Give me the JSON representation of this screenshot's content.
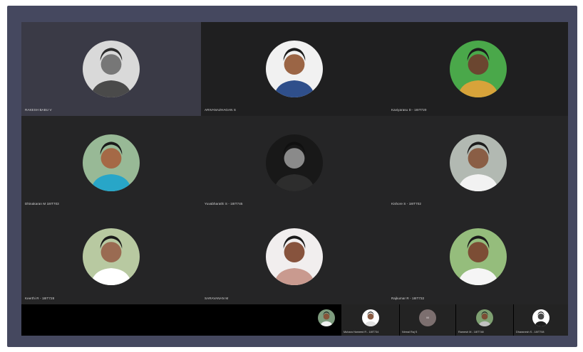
{
  "colors": {
    "frame": "#45485f",
    "meeting_bg": "#1e1e1e",
    "tile_bg": "#252526",
    "active_tile_bg": "#3a3a46",
    "strip_bg": "#000000"
  },
  "participants": [
    {
      "name": "RAKESH BABU V",
      "active": true,
      "bg": "#d9d9d9",
      "skin": "#777777",
      "shirt": "#4a4a4a",
      "hair": "#2c2c2c"
    },
    {
      "name": "ARIVANAZHAGAN S",
      "active": false,
      "bg": "#f1f1f1",
      "skin": "#9b6545",
      "shirt": "#2f4f8b",
      "hair": "#1a1a1a"
    },
    {
      "name": "Kaviyarasu D - 18IT720",
      "active": false,
      "bg": "#4aa84a",
      "skin": "#6b4630",
      "shirt": "#d7a33a",
      "hair": "#1b1b1b"
    },
    {
      "name": "Dhinakaran M 18IT703",
      "active": false,
      "bg": "#98b996",
      "skin": "#a56946",
      "shirt": "#28a6c8",
      "hair": "#1a1a1a"
    },
    {
      "name": "Yuvabharathi S - 18IT745",
      "active": false,
      "bg": "#181818",
      "skin": "#8a8a8a",
      "shirt": "#2d2d2d",
      "hair": "#101010"
    },
    {
      "name": "Kishore S - 18IT702",
      "active": false,
      "bg": "#b2b9b2",
      "skin": "#8a5e45",
      "shirt": "#f2f2f2",
      "hair": "#1b1b1b"
    },
    {
      "name": "Keerthi R - 18IT728",
      "active": false,
      "bg": "#b8c9a1",
      "skin": "#9a6b52",
      "shirt": "#ffffff",
      "hair": "#1a1a1a"
    },
    {
      "name": "SARAVANAN M",
      "active": false,
      "bg": "#f1eeee",
      "skin": "#87533d",
      "shirt": "#c99a8f",
      "hair": "#1a1a1a"
    },
    {
      "name": "Rajkumar R - 18IT732",
      "active": false,
      "bg": "#95bd7c",
      "skin": "#7c4d35",
      "shirt": "#f5f5f5",
      "hair": "#1a1a1a"
    }
  ],
  "strip": [
    {
      "name": "",
      "kind": "photo",
      "bg": "#7d9b7d",
      "skin": "#87543a",
      "shirt": "#f0f0f0",
      "hair": "#1a1a1a"
    },
    {
      "name": "Muhara Hameed R - 18IT734",
      "kind": "photo",
      "bg": "#ffffff",
      "skin": "#8b5d45",
      "shirt": "#e0e0e0",
      "hair": "#1a1a1a"
    },
    {
      "name": "Nirmal Raj S",
      "kind": "initials",
      "initials": "M"
    },
    {
      "name": "Ramesh M - 18IT748",
      "kind": "photo",
      "bg": "#7ea071",
      "skin": "#7c4e35",
      "shirt": "#c1c1c1",
      "hair": "#1a1a1a"
    },
    {
      "name": "Dharanesh S - 18IT708",
      "kind": "photo",
      "bg": "#ffffff",
      "skin": "#4a4a4a",
      "shirt": "#1e1e1e",
      "hair": "#101010"
    }
  ]
}
